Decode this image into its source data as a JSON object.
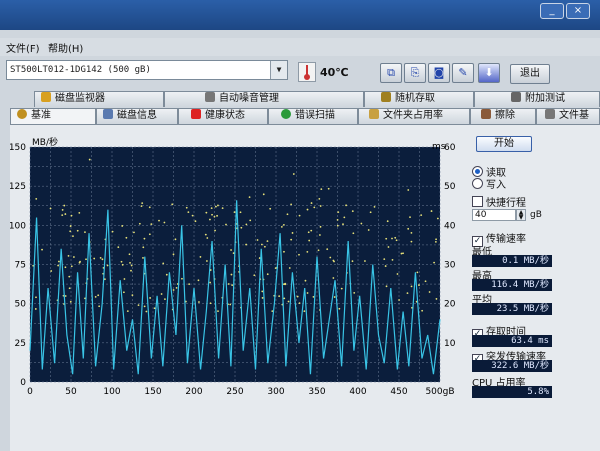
{
  "menu": {
    "file": "文件(F)",
    "help": "帮助(H)"
  },
  "toolbar": {
    "drive": "ST500LT012-1DG142 (500 gB)",
    "temperature": "40℃",
    "exit_label": "退出"
  },
  "tabs_row1": [
    "磁盘监视器",
    "自动噪音管理",
    "随机存取",
    "附加测试"
  ],
  "tabs_row2": [
    "基准",
    "磁盘信息",
    "健康状态",
    "错误扫描",
    "文件夹占用率",
    "擦除",
    "文件基"
  ],
  "controls": {
    "start": "开始",
    "read": "读取",
    "write": "写入",
    "short_stroke": "快捷行程",
    "stroke_value": "40",
    "stroke_unit": "gB",
    "transfer_rate": "传输速率",
    "min_label": "最低",
    "min_value": "0.1 MB/秒",
    "max_label": "最高",
    "max_value": "116.4 MB/秒",
    "avg_label": "平均",
    "avg_value": "23.5 MB/秒",
    "access_time": "存取时间",
    "access_value": "63.4 ms",
    "burst_rate": "突发传输速率",
    "burst_value": "322.6 MB/秒",
    "cpu_label": "CPU 占用率",
    "cpu_value": "5.8%"
  },
  "colors": {
    "chart_bg": "#0b1e3c",
    "grid": "#6f7f99",
    "transfer_line": "#39c4e6",
    "access_dots": "#e8e27a"
  },
  "chart_data": {
    "type": "line",
    "ylabel_left": "MB/秒",
    "ylabel_right": "ms",
    "xlabel_unit": "gB",
    "xlim": [
      0,
      500
    ],
    "ylim_left": [
      0,
      150
    ],
    "ylim_right": [
      0,
      60
    ],
    "xticks": [
      0,
      50,
      100,
      150,
      200,
      250,
      300,
      350,
      400,
      450,
      500
    ],
    "yticks_left": [
      0,
      25,
      50,
      75,
      100,
      125,
      150
    ],
    "yticks_right": [
      10,
      20,
      30,
      40,
      50,
      60
    ],
    "grid": true,
    "series": [
      {
        "name": "传输速率",
        "x": [
          0,
          8,
          15,
          22,
          30,
          38,
          45,
          52,
          58,
          65,
          72,
          80,
          88,
          95,
          102,
          110,
          118,
          125,
          132,
          140,
          148,
          155,
          162,
          170,
          178,
          185,
          192,
          200,
          208,
          215,
          222,
          230,
          238,
          245,
          252,
          260,
          268,
          275,
          282,
          290,
          298,
          305,
          312,
          320,
          328,
          335,
          342,
          350,
          358,
          365,
          372,
          380,
          388,
          395,
          402,
          410,
          418,
          425,
          432,
          440,
          448,
          455,
          462,
          470,
          478,
          485,
          492,
          500
        ],
        "y": [
          20,
          105,
          8,
          60,
          12,
          85,
          30,
          5,
          70,
          15,
          95,
          10,
          50,
          110,
          8,
          65,
          20,
          40,
          5,
          80,
          15,
          55,
          10,
          70,
          30,
          100,
          12,
          60,
          8,
          45,
          90,
          15,
          75,
          10,
          116,
          20,
          60,
          8,
          85,
          12,
          50,
          95,
          10,
          70,
          25,
          60,
          5,
          80,
          15,
          40,
          65,
          10,
          90,
          20,
          55,
          8,
          75,
          30,
          12,
          60,
          8,
          45,
          10,
          70,
          15,
          30,
          5,
          40
        ]
      },
      {
        "name": "存取时间",
        "scatter_density": "dense band between 20 and 45 ms across capacity"
      }
    ]
  }
}
